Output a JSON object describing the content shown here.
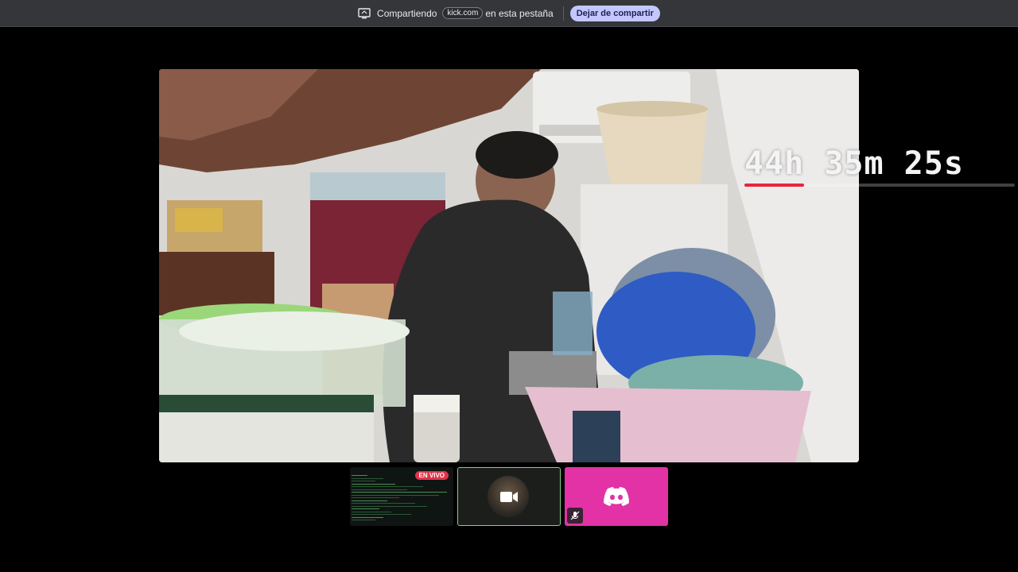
{
  "share_bar": {
    "sharing_label": "Compartiendo",
    "domain": "kick.com",
    "tab_label": "en esta pestaña",
    "stop_button": "Dejar de compartir"
  },
  "overlay": {
    "timer": "44h 35m 25s",
    "progress_fraction": 0.22,
    "accent_color": "#e8233d"
  },
  "thumbnails": {
    "live_badge": "EN VIVO",
    "camera_icon": "video-camera-icon",
    "discord_icon": "discord-icon",
    "mic_icon": "mic-off-icon"
  },
  "colors": {
    "share_bar_bg": "#35363a",
    "stop_button_bg": "#c4c7ff",
    "discord_tile": "#e331a6",
    "cam_border": "#7fcf8b"
  }
}
